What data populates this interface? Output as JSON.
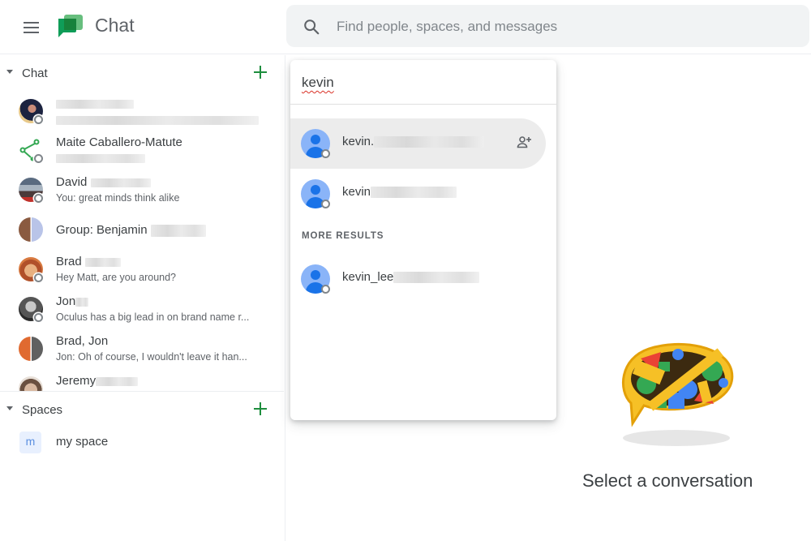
{
  "header": {
    "app_title": "Chat",
    "menu_icon": "hamburger-menu-icon",
    "logo_icon": "google-chat-logo",
    "search": {
      "placeholder": "Find people, spaces, and messages",
      "icon": "search-icon"
    }
  },
  "sidebar": {
    "chat_section": {
      "label": "Chat",
      "add_icon": "plus-icon",
      "items": [
        {
          "name": "",
          "snippet": "",
          "avatar": "photo",
          "status": "offline",
          "name_redacted": true,
          "snippet_redacted": true
        },
        {
          "name": "Maite Caballero-Matute",
          "snippet": "",
          "avatar": "bot-tree-icon",
          "status": "offline",
          "snippet_redacted": true
        },
        {
          "name": "David",
          "snippet": "You: great minds think alike",
          "avatar": "photo",
          "status": "offline",
          "name_redacted": true
        },
        {
          "name": "Group: Benjamin",
          "snippet": "",
          "avatar": "group-photo",
          "name_redacted": true
        },
        {
          "name": "Brad",
          "snippet": "Hey Matt, are you around?",
          "avatar": "photo",
          "status": "offline",
          "name_redacted": true
        },
        {
          "name": "Jon",
          "snippet": "Oculus has a big lead in on brand name r...",
          "avatar": "photo",
          "status": "offline",
          "name_redacted": true
        },
        {
          "name": "Brad, Jon",
          "snippet": "Jon: Oh of course, I wouldn't leave it han...",
          "avatar": "group-photo"
        },
        {
          "name": "Jeremy",
          "snippet": "",
          "avatar": "photo",
          "name_redacted": true
        }
      ]
    },
    "spaces_section": {
      "label": "Spaces",
      "add_icon": "plus-icon",
      "items": [
        {
          "initial": "m",
          "name": "my space"
        }
      ]
    }
  },
  "search_dropdown": {
    "query": "kevin",
    "results": [
      {
        "name": "kevin.",
        "redacted": true,
        "action_icon": "add-person-icon",
        "highlighted": true
      },
      {
        "name": "kevin",
        "redacted": true
      }
    ],
    "more_results_label": "MORE RESULTS",
    "more_results": [
      {
        "name": "kevin_lee",
        "redacted": true
      }
    ]
  },
  "main": {
    "empty_state_text": "Select a conversation",
    "illustration": "chat-bubble-shapes-illustration"
  },
  "colors": {
    "accent_green": "#1e8e3e",
    "avatar_blue": "#1a73e8",
    "avatar_light_blue": "#8ab4f8",
    "search_bg": "#f1f3f4",
    "highlight_bg": "#ececec"
  }
}
